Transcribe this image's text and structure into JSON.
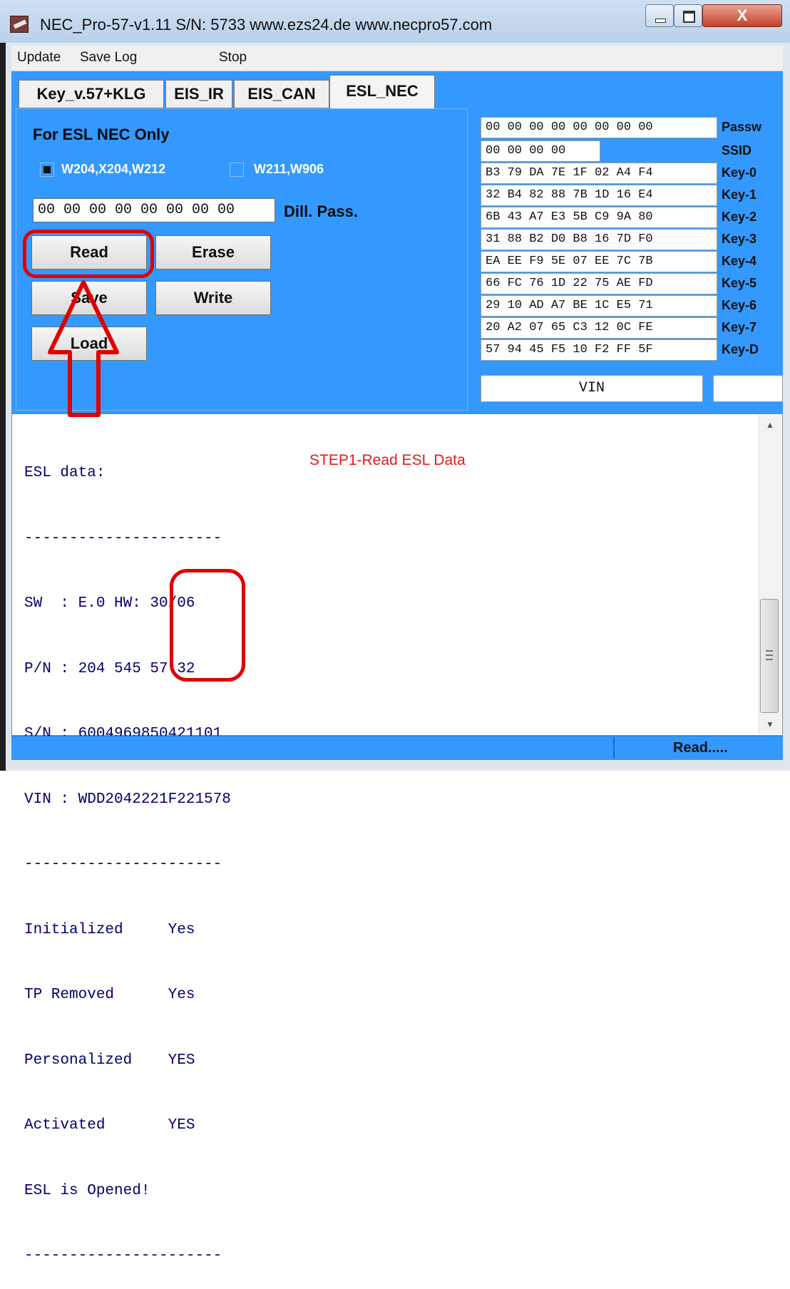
{
  "window": {
    "title": "NEC_Pro-57-v1.11   S/N:  5733   www.ezs24.de   www.necpro57.com",
    "close_glyph": "X"
  },
  "menu": {
    "update": "Update",
    "save_log": "Save Log",
    "stop": "Stop"
  },
  "tabs": [
    {
      "label": "Key_v.57+KLG",
      "active": false
    },
    {
      "label": "EIS_IR",
      "active": false
    },
    {
      "label": "EIS_CAN",
      "active": false
    },
    {
      "label": "ESL_NEC",
      "active": true
    }
  ],
  "panel": {
    "title": "For ESL NEC Only",
    "check1_label": "W204,X204,W212",
    "check1_checked": true,
    "check2_label": "W211,W906",
    "check2_checked": false,
    "pass_value": "00 00 00 00 00 00 00 00",
    "pass_label": "Dill. Pass.",
    "buttons": {
      "read": "Read",
      "erase": "Erase",
      "save": "Save",
      "write": "Write",
      "load": "Load"
    }
  },
  "key_table": [
    {
      "hex": "00 00 00 00 00 00 00 00",
      "label": "Passw"
    },
    {
      "hex": "00 00 00 00",
      "label": "SSID"
    },
    {
      "hex": "B3 79 DA 7E 1F 02 A4 F4",
      "label": "Key-0"
    },
    {
      "hex": "32 B4 82 88 7B 1D 16 E4",
      "label": "Key-1"
    },
    {
      "hex": "6B 43 A7 E3 5B C9 9A 80",
      "label": "Key-2"
    },
    {
      "hex": "31 88 B2 D0 B8 16 7D F0",
      "label": "Key-3"
    },
    {
      "hex": "EA EE F9 5E 07 EE 7C 7B",
      "label": "Key-4"
    },
    {
      "hex": "66 FC 76 1D 22 75 AE FD",
      "label": "Key-5"
    },
    {
      "hex": "29 10 AD A7 BE 1C E5 71",
      "label": "Key-6"
    },
    {
      "hex": "20 A2 07 65 C3 12 0C FE",
      "label": "Key-7"
    },
    {
      "hex": "57 94 45 F5 10 F2 FF 5F",
      "label": "Key-D"
    }
  ],
  "vin_label": "VIN",
  "log": {
    "lines": [
      "ESL data:",
      "----------------------",
      "SW  : E.0 HW: 30/06",
      "P/N : 204 545 57 32",
      "S/N : 6004969850421101",
      "VIN : WDD2042221F221578",
      "----------------------",
      "Initialized     Yes",
      "TP Removed      Yes",
      "Personalized    YES",
      "Activated       YES",
      "ESL is Opened!",
      "----------------------"
    ],
    "annotation": "STEP1-Read ESL Data"
  },
  "status": {
    "text": "Read....."
  },
  "colors": {
    "panel_blue": "#3399ff",
    "log_text": "#00006b",
    "annotation_red": "#e21a1a"
  }
}
